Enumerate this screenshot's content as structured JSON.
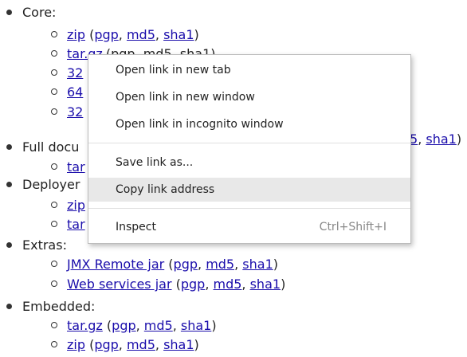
{
  "categories": [
    {
      "label": "Core:"
    },
    {
      "label": "Full docu"
    },
    {
      "label": "Deployer"
    },
    {
      "label": "Extras:"
    },
    {
      "label": "Embedded:"
    }
  ],
  "core_items": [
    {
      "main": "zip",
      "pgp": "pgp",
      "md5": "md5",
      "sha1": "sha1"
    },
    {
      "main": "tar.gz",
      "partial": "(pgp, md5, sha1)"
    },
    {
      "main": "32"
    },
    {
      "main": "64"
    },
    {
      "main": "32",
      "md5_tail": "5",
      "sha1": "sha1"
    }
  ],
  "full_doc_items": [
    {
      "main": "tar"
    }
  ],
  "deployer_items": [
    {
      "main": "zip"
    },
    {
      "main": "tar"
    }
  ],
  "extras_items": [
    {
      "main": "JMX Remote jar",
      "pgp": "pgp",
      "md5": "md5",
      "sha1": "sha1"
    },
    {
      "main": "Web services jar",
      "pgp": "pgp",
      "md5": "md5",
      "sha1": "sha1"
    }
  ],
  "embedded_items": [
    {
      "main": "tar.gz",
      "pgp": "pgp",
      "md5": "md5",
      "sha1": "sha1"
    },
    {
      "main": "zip",
      "pgp": "pgp",
      "md5": "md5",
      "sha1": "sha1"
    }
  ],
  "context_menu": {
    "open_new_tab": "Open link in new tab",
    "open_new_window": "Open link in new window",
    "open_incognito": "Open link in incognito window",
    "save_link_as": "Save link as...",
    "copy_link_address": "Copy link address",
    "inspect": "Inspect",
    "inspect_shortcut": "Ctrl+Shift+I"
  },
  "punct": {
    "open": " (",
    "comma": ", ",
    "close": ")"
  }
}
